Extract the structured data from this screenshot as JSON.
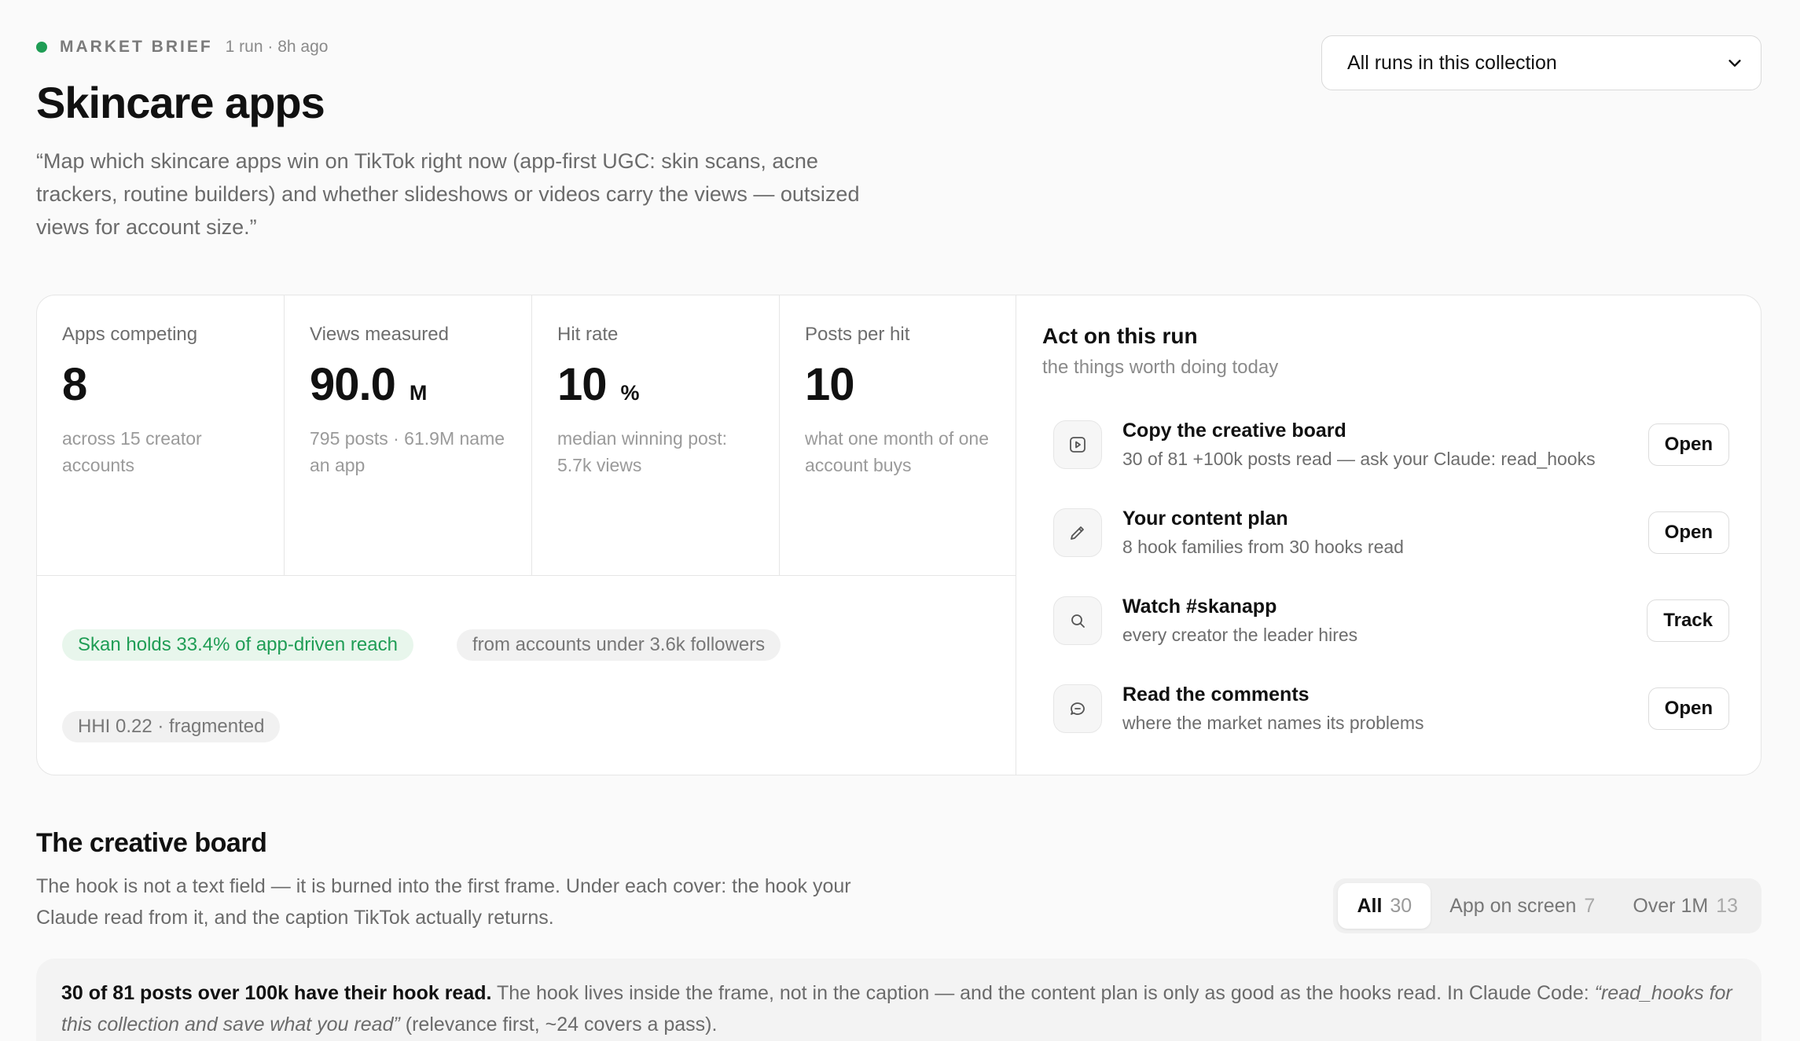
{
  "header": {
    "eyebrow_label": "MARKET BRIEF",
    "eyebrow_meta": "1 run · 8h ago",
    "title": "Skincare apps",
    "prompt": "“Map which skincare apps win on TikTok right now (app-first UGC: skin scans, acne trackers, routine builders) and whether slideshows or videos carry the views — outsized views for account size.”",
    "run_select_value": "All runs in this collection",
    "status_color": "#1f9d55"
  },
  "stats": [
    {
      "label": "Apps competing",
      "value": "8",
      "unit": "",
      "note": "across 15 creator accounts"
    },
    {
      "label": "Views measured",
      "value": "90.0",
      "unit": "M",
      "note": "795 posts · 61.9M name an app"
    },
    {
      "label": "Hit rate",
      "value": "10",
      "unit": "%",
      "note": "median winning post: 5.7k views"
    },
    {
      "label": "Posts per hit",
      "value": "10",
      "unit": "",
      "note": "what one month of one account buys"
    }
  ],
  "chips": {
    "reach": "Skan holds 33.4% of app-driven reach",
    "followers": "from accounts under 3.6k followers",
    "hhi": "HHI 0.22 · fragmented"
  },
  "act": {
    "title": "Act on this run",
    "subtitle": "the things worth doing today",
    "items": [
      {
        "name": "Copy the creative board",
        "desc": "30 of 81 +100k posts read — ask your Claude: read_hooks",
        "button": "Open",
        "icon": "play-square-icon"
      },
      {
        "name": "Your content plan",
        "desc": "8 hook families from 30 hooks read",
        "button": "Open",
        "icon": "pencil-icon"
      },
      {
        "name": "Watch #skanapp",
        "desc": "every creator the leader hires",
        "button": "Track",
        "icon": "search-icon"
      },
      {
        "name": "Read the comments",
        "desc": "where the market names its problems",
        "button": "Open",
        "icon": "chat-bubble-icon"
      }
    ]
  },
  "board": {
    "title": "The creative board",
    "desc": "The hook is not a text field — it is burned into the first frame. Under each cover: the hook your Claude read from it, and the caption TikTok actually returns.",
    "filters": [
      {
        "label": "All",
        "count": "30"
      },
      {
        "label": "App on screen",
        "count": "7"
      },
      {
        "label": "Over 1M",
        "count": "13"
      }
    ],
    "notice_strong": "30 of 81 posts over 100k have their hook read.",
    "notice_text": " The hook lives inside the frame, not in the caption — and the content plan is only as good as the hooks read. In Claude Code: ",
    "notice_em": "“read_hooks for this collection and save what you read”",
    "notice_tail": " (relevance first, ~24 covers a pass)."
  }
}
